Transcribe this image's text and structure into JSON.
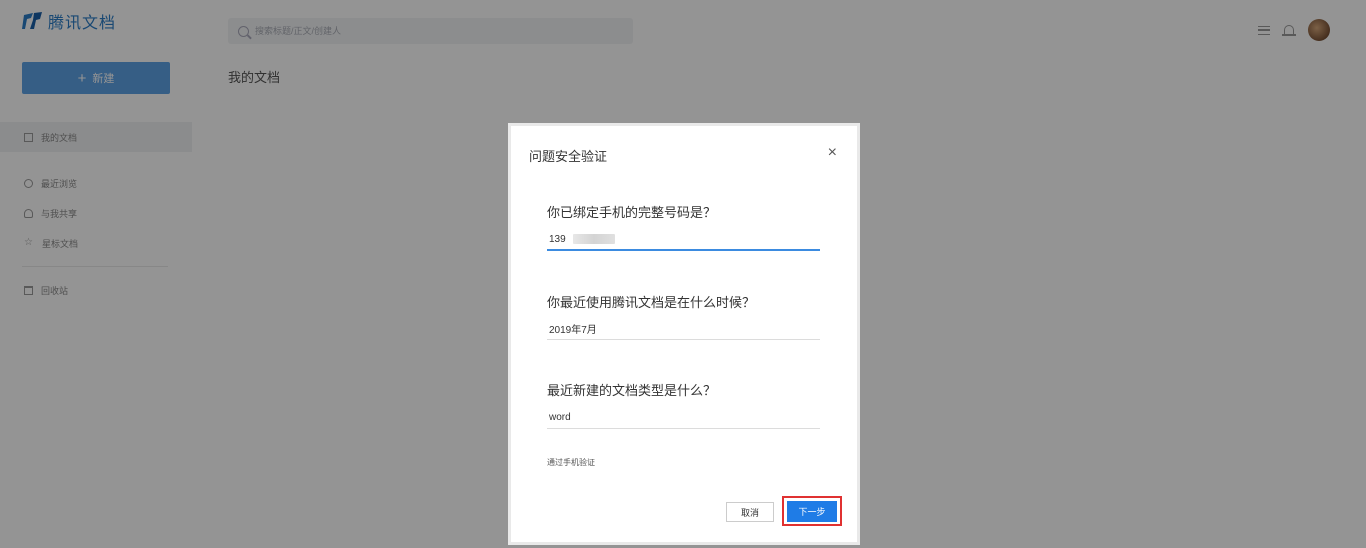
{
  "app": {
    "name": "腾讯文档",
    "search_placeholder": "搜索标题/正文/创建人",
    "new_button": "新建",
    "page_title": "我的文档"
  },
  "sidebar": {
    "items": [
      {
        "label": "我的文档",
        "icon": "document-icon"
      },
      {
        "label": "最近浏览",
        "icon": "clock-icon"
      },
      {
        "label": "与我共享",
        "icon": "person-icon"
      },
      {
        "label": "星标文档",
        "icon": "star-icon"
      },
      {
        "label": "回收站",
        "icon": "trash-icon"
      }
    ]
  },
  "dialog": {
    "title": "问题安全验证",
    "close": "×",
    "questions": [
      {
        "label": "你已绑定手机的完整号码是？",
        "value": "139"
      },
      {
        "label": "你最近使用腾讯文档是在什么时候？",
        "value": "2019年7月"
      },
      {
        "label": "最近新建的文档类型是什么？",
        "value": "word"
      }
    ],
    "alt_link": "通过手机验证",
    "cancel": "取消",
    "next": "下一步"
  },
  "colors": {
    "brand": "#2b7dc7",
    "primary": "#1f7ce6",
    "highlight": "#e03131"
  }
}
